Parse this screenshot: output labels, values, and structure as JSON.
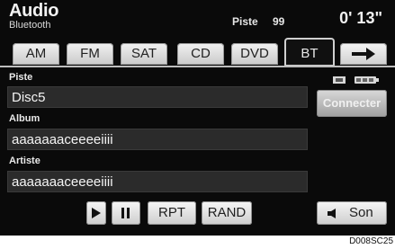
{
  "header": {
    "title": "Audio",
    "subtitle": "Bluetooth",
    "track_label": "Piste",
    "track_number": "99",
    "time": "0' 13\""
  },
  "tabs": [
    {
      "label": "AM",
      "active": false
    },
    {
      "label": "FM",
      "active": false
    },
    {
      "label": "SAT",
      "active": false
    },
    {
      "label": "CD",
      "active": false
    },
    {
      "label": "DVD",
      "active": false
    },
    {
      "label": "BT",
      "active": true
    }
  ],
  "next_tab_icon": "arrow-right-icon",
  "fields": {
    "track": {
      "label": "Piste",
      "value": "Disc5"
    },
    "album": {
      "label": "Album",
      "value": "aaaaaaaceeeeiiii"
    },
    "artist": {
      "label": "Artiste",
      "value": "aaaaaaaceeeeiiii"
    }
  },
  "right_panel": {
    "connect_label": "Connecter",
    "status_icons": [
      "signal-icon",
      "battery-icon"
    ]
  },
  "controls": {
    "play_icon": "play-icon",
    "pause_icon": "pause-icon",
    "repeat_label": "RPT",
    "random_label": "RAND",
    "sound_label": "Son",
    "sound_icon": "speaker-icon"
  },
  "image_code": "D008SC25"
}
